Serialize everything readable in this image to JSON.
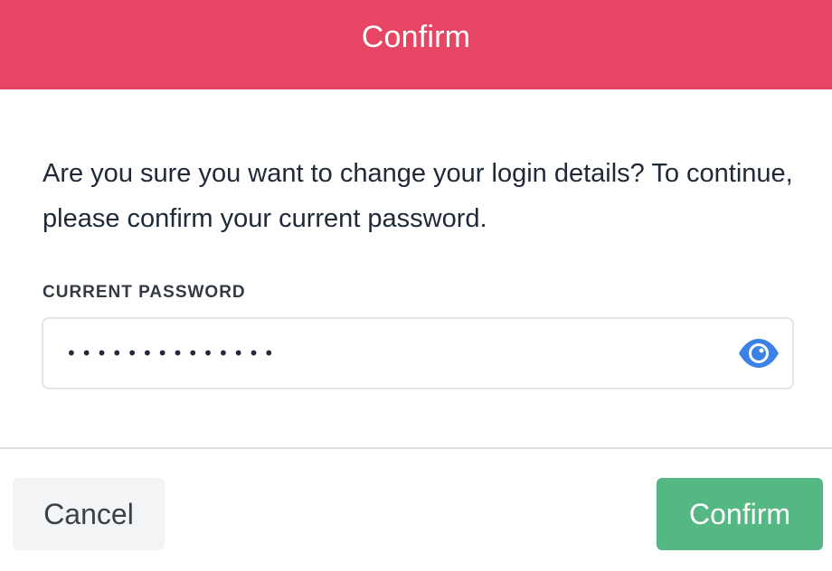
{
  "header": {
    "title": "Confirm"
  },
  "body": {
    "message": "Are you sure you want to change your login details? To continue, please confirm your current password.",
    "password_label": "CURRENT PASSWORD",
    "password_value": "••••••••••••••",
    "password_icon": "eye-icon"
  },
  "footer": {
    "cancel_label": "Cancel",
    "confirm_label": "Confirm"
  },
  "colors": {
    "header_bg": "#e64664",
    "confirm_bg": "#55b784",
    "cancel_bg": "#f3f4f6",
    "eye_icon": "#3b82e6"
  }
}
